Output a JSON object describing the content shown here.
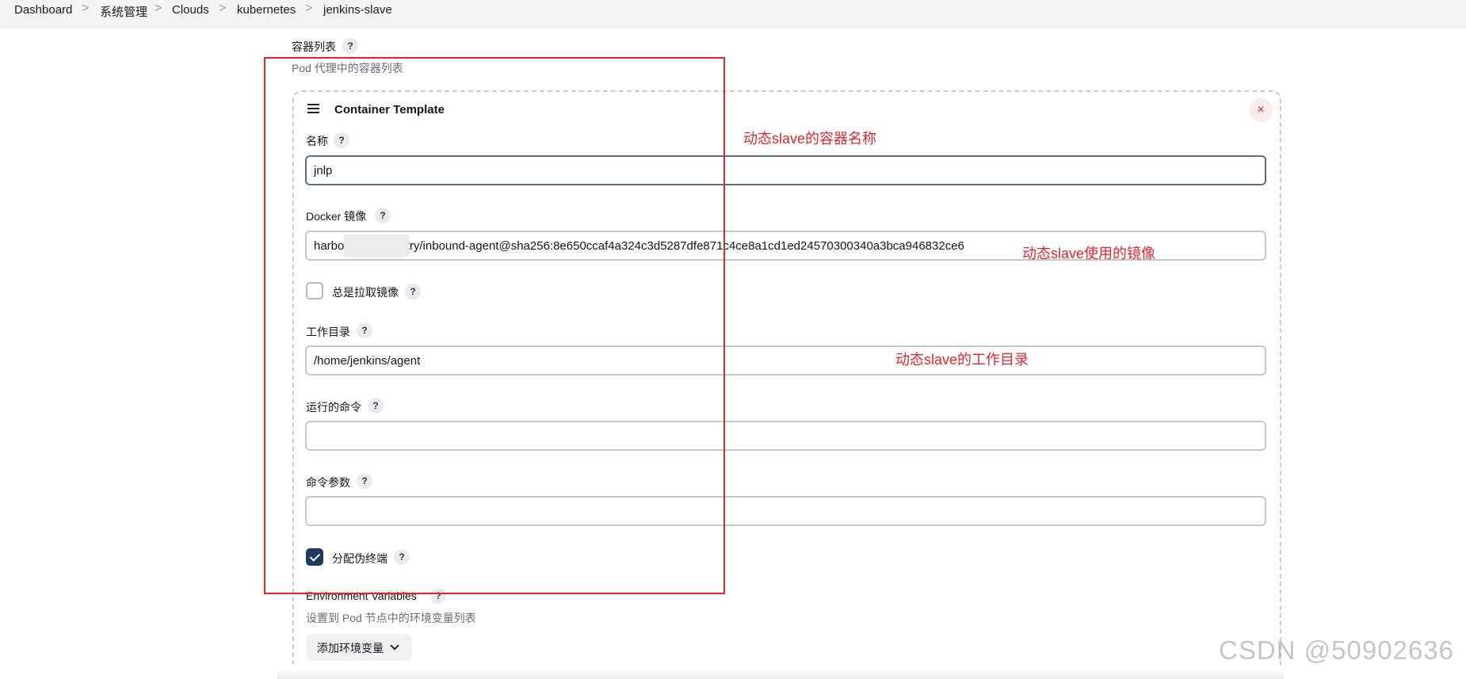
{
  "breadcrumb": {
    "items": [
      "Dashboard",
      "系统管理",
      "Clouds",
      "kubernetes",
      "jenkins-slave"
    ],
    "separator": ">"
  },
  "container_list": {
    "title": "容器列表",
    "description": "Pod 代理中的容器列表",
    "help": "?"
  },
  "template": {
    "heading": "Container Template",
    "close_glyph": "×",
    "name": {
      "label": "名称",
      "value": "jnlp",
      "help": "?"
    },
    "docker_image": {
      "label": "Docker 镜像",
      "value": "harbo          /registry/inbound-agent@sha256:8e650ccaf4a324c3d5287dfe871c4ce8a1cd1ed24570300340a3bca946832ce6",
      "help": "?"
    },
    "always_pull": {
      "label": "总是拉取镜像",
      "checked": false,
      "help": "?"
    },
    "working_dir": {
      "label": "工作目录",
      "value": "/home/jenkins/agent",
      "help": "?"
    },
    "command": {
      "label": "运行的命令",
      "value": "",
      "help": "?"
    },
    "args": {
      "label": "命令参数",
      "value": "",
      "help": "?"
    },
    "allocate_tty": {
      "label": "分配伪终端",
      "checked": true,
      "help": "?"
    },
    "env_vars": {
      "label": "Environment Variables",
      "description": "设置到 Pod 节点中的环境变量列表",
      "add_button": "添加环境变量",
      "help": "?"
    }
  },
  "annotations": {
    "name": "动态slave的容器名称",
    "image": "动态slave使用的镜像",
    "workdir": "动态slave的工作目录"
  },
  "watermark": "CSDN @50902636",
  "colors": {
    "annotation_red": "#e3262a",
    "checkbox_checked": "#1d3a5f",
    "close_button_bg": "#fdeaea"
  }
}
